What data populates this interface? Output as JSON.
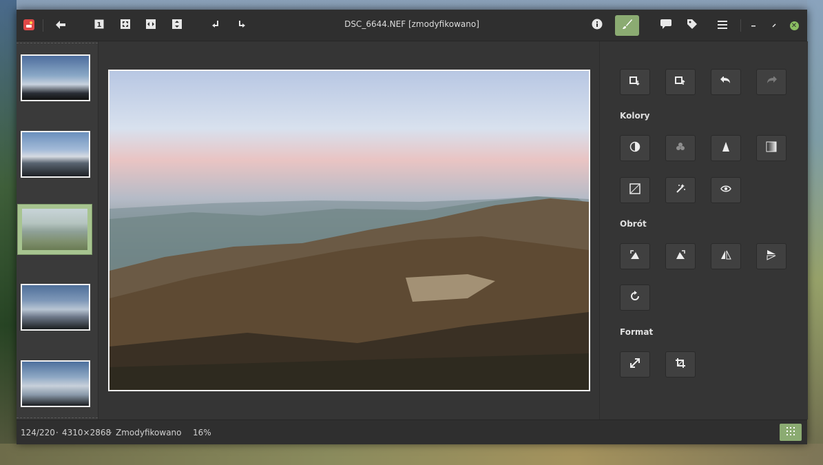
{
  "window": {
    "title": "DSC_6644.NEF [zmodyfikowano]"
  },
  "toolbar": {
    "back_icon": "arrow-left-icon",
    "zoom_1_icon": "zoom-original-icon",
    "zoom_fit_icon": "zoom-fit-icon",
    "fit_width_icon": "fit-width-icon",
    "fit_height_icon": "fit-height-icon",
    "rotate_left_icon": "rotate-left-icon",
    "rotate_right_icon": "rotate-right-icon",
    "info_icon": "info-icon",
    "edit_icon": "brush-icon",
    "comment_icon": "comment-icon",
    "tag_icon": "tag-icon",
    "menu_icon": "menu-icon",
    "minimize_icon": "minimize-icon",
    "restore_icon": "restore-icon",
    "close_icon": "close-icon",
    "accent_color": "#8bab72"
  },
  "thumbnails": [
    {
      "name": "thumb-1",
      "selected": false
    },
    {
      "name": "thumb-2",
      "selected": false
    },
    {
      "name": "thumb-3",
      "selected": true
    },
    {
      "name": "thumb-4",
      "selected": false
    },
    {
      "name": "thumb-5",
      "selected": false
    }
  ],
  "panel": {
    "top_tools": [
      "copy-edits-icon",
      "paste-edits-icon",
      "undo-icon",
      "redo-icon"
    ],
    "colors_label": "Kolory",
    "color_tools": [
      "contrast-icon",
      "channels-icon",
      "sharpen-icon",
      "levels-icon",
      "curves-icon",
      "auto-fix-icon",
      "red-eye-icon"
    ],
    "rotation_label": "Obrót",
    "rotation_tools": [
      "rotate-left-icon",
      "rotate-right-icon",
      "flip-horizontal-icon",
      "flip-vertical-icon",
      "straighten-icon"
    ],
    "format_label": "Format",
    "format_tools": [
      "resize-icon",
      "crop-icon"
    ]
  },
  "status": {
    "position": "124/220",
    "sep1": "·",
    "dimensions": "4310×2868",
    "sep2": "·",
    "state": "Zmodyfikowano",
    "zoom": "16%"
  }
}
